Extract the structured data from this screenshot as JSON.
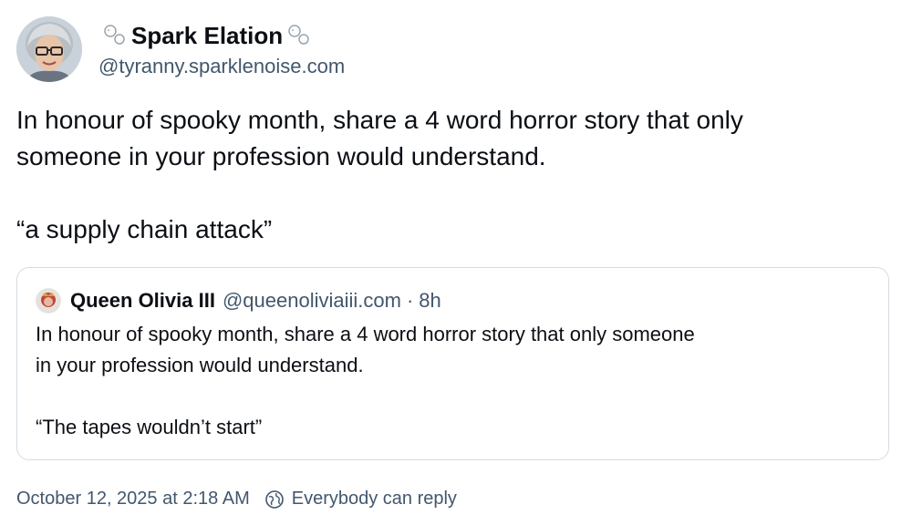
{
  "post": {
    "author": {
      "display_name": "Spark Elation",
      "handle": "@tyranny.sparklenoise.com",
      "name_decoration_icon": "bubbles-icon"
    },
    "text": "In honour of spooky month, share a 4 word horror story that only\nsomeone in your profession would understand.\n\n“a supply chain attack”",
    "quoted_post": {
      "author_name": "Queen Olivia III",
      "author_handle": "@queenoliviaiii.com",
      "separator": "·",
      "age": "8h",
      "text": "In honour of spooky month, share a 4 word horror story that only someone\nin your profession would understand.\n\n“The tapes wouldn’t start”"
    },
    "footer": {
      "timestamp": "October 12, 2025 at 2:18 AM",
      "reply_setting": "Everybody can reply",
      "reply_setting_icon": "globe-icon"
    }
  },
  "colors": {
    "text_primary": "#0b0f14",
    "text_secondary": "#42576c",
    "border": "#d4dbe2"
  }
}
